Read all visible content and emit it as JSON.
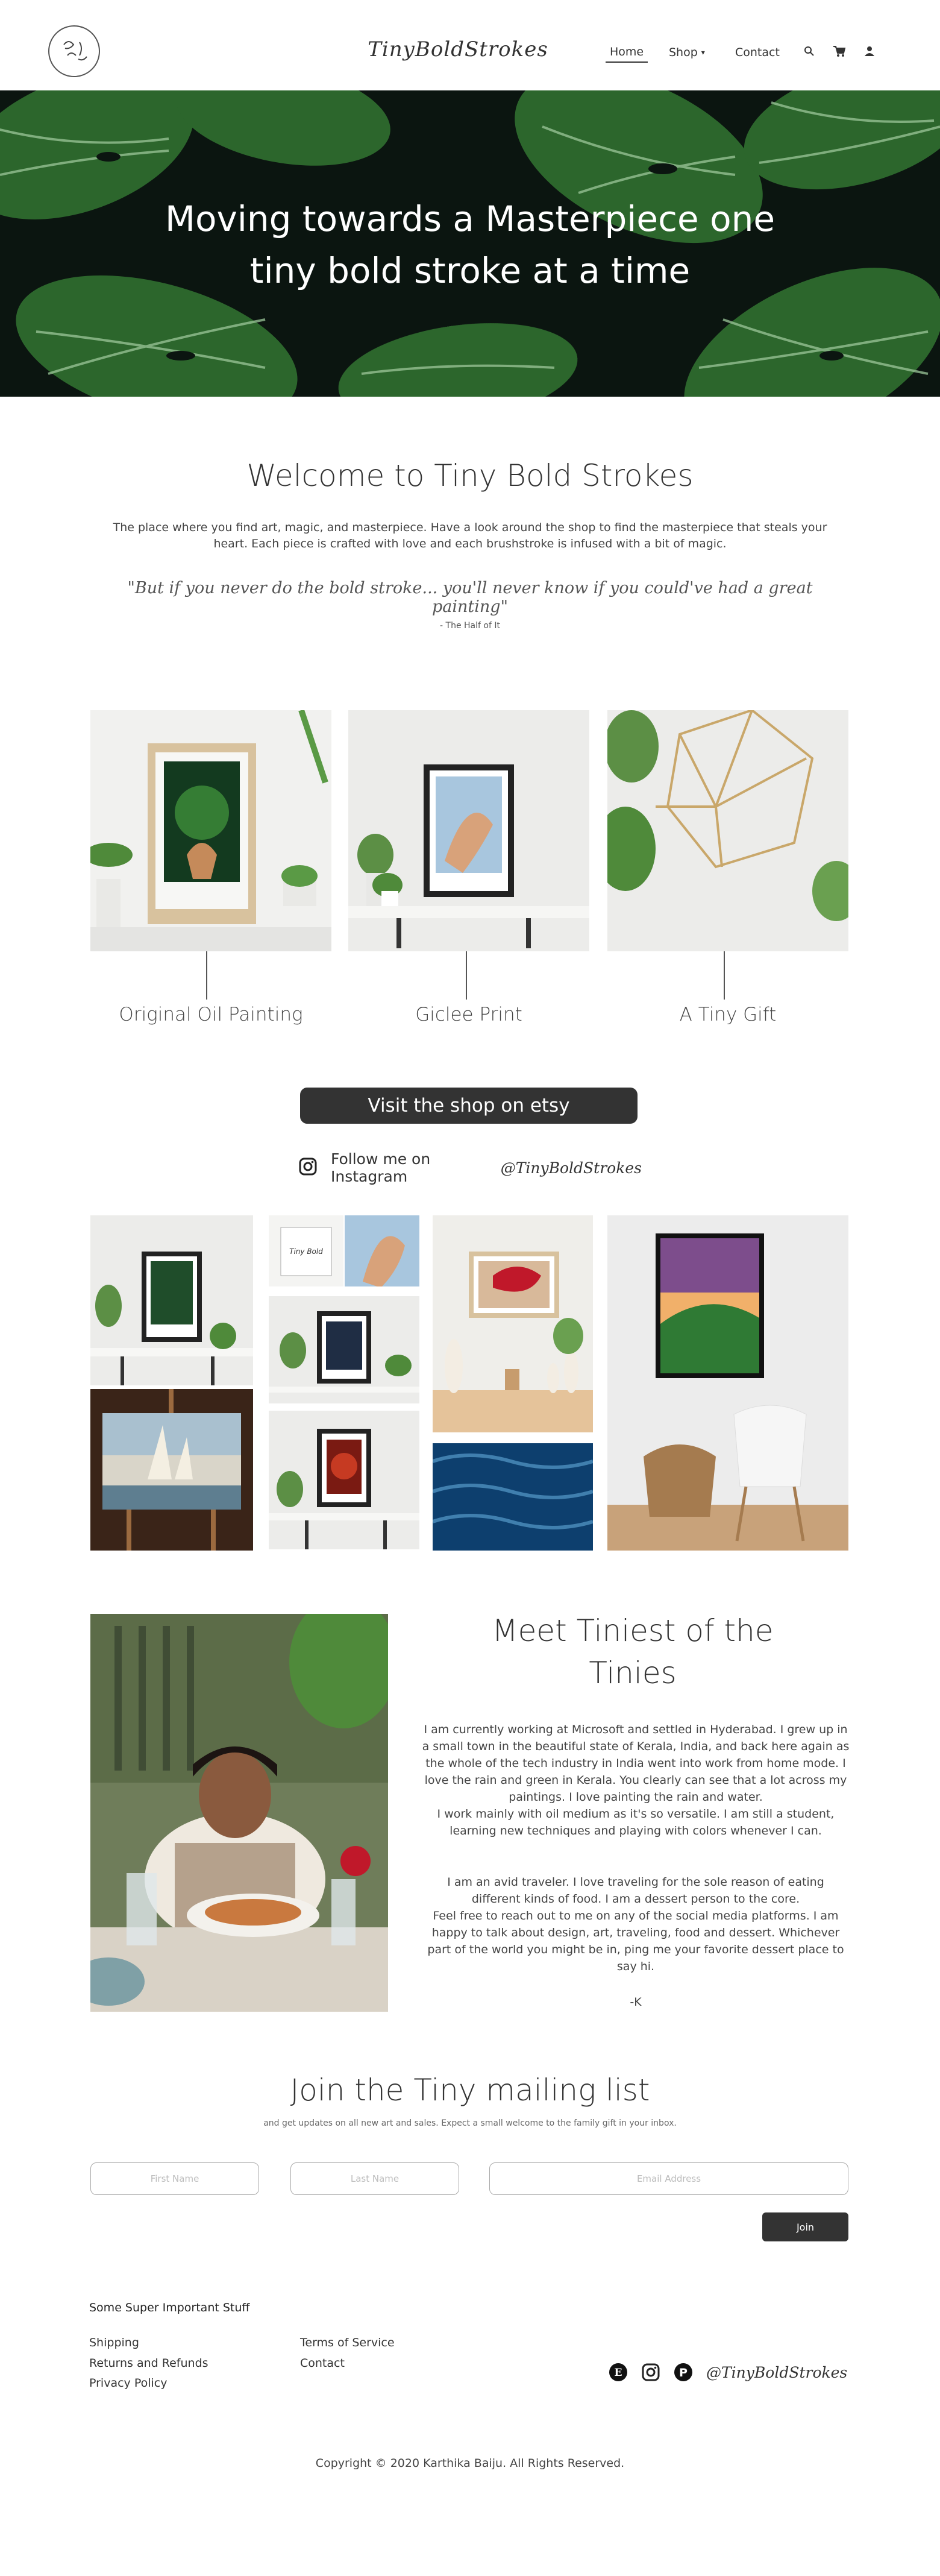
{
  "header": {
    "brand": "TinyBoldStrokes",
    "nav": {
      "home": "Home",
      "shop": "Shop",
      "contact": "Contact"
    },
    "icons": [
      "search-icon",
      "cart-icon",
      "account-icon"
    ]
  },
  "hero": {
    "title_line1": "Moving towards a Masterpiece one",
    "title_line2": "tiny bold stroke at a time"
  },
  "welcome": {
    "title": "Welcome to Tiny Bold Strokes",
    "text": "The place where you find art, magic, and masterpiece. Have a look around the shop to find the masterpiece that steals your heart. Each piece is crafted with love and each brushstroke is infused with a bit of magic.",
    "quote": "\"But if you never do the bold stroke... you'll never know if you could've had a great painting\"",
    "quote_author": "- The Half of It"
  },
  "products": [
    {
      "label": "Original Oil Painting"
    },
    {
      "label": "Giclee Print"
    },
    {
      "label": "A Tiny Gift"
    }
  ],
  "etsy": {
    "button": "Visit the shop on etsy"
  },
  "instagram": {
    "text": "Follow me on Instagram",
    "handle": "@TinyBoldStrokes"
  },
  "about": {
    "title_line1": "Meet Tiniest of the",
    "title_line2": "Tinies",
    "p1": "I am currently working at Microsoft and settled in Hyderabad. I grew up in a small town in the beautiful state of Kerala, India, and back here again as the whole of the tech industry in India went into work from home mode. I love the rain and green in Kerala. You clearly can see that a lot across my paintings. I love painting the rain and water.",
    "p1b": "I work mainly with oil medium as it's so versatile. I am still a student, learning new techniques and playing with colors whenever I can.",
    "p2": "I am an avid traveler. I love traveling for the sole reason of eating different kinds of food. I am a dessert person to the core.",
    "p2b": "Feel free to reach out to me on any of the social media platforms. I am happy to talk about design, art, traveling, food and dessert. Whichever part of the world you might be in, ping me your favorite dessert place to say hi.",
    "sign": "-K"
  },
  "mailing": {
    "title": "Join the Tiny mailing list",
    "subtitle": "and get updates on all new art and sales. Expect a small welcome to the family gift in your inbox.",
    "first_name_placeholder": "First Name",
    "last_name_placeholder": "Last Name",
    "email_placeholder": "Email Address",
    "join": "Join"
  },
  "footer": {
    "heading": "Some Super Important Stuff",
    "col1": [
      "Shipping",
      "Returns and Refunds",
      "Privacy Policy"
    ],
    "col2": [
      "Terms of Service",
      "Contact"
    ],
    "brand": "@TinyBoldStrokes",
    "social_icons": [
      "etsy-icon",
      "instagram-icon",
      "pinterest-icon"
    ],
    "copyright": "Copyright © 2020 Karthika Baiju. All Rights Reserved."
  },
  "colors": {
    "dark": "#333333",
    "hero_bg": "#0b1510",
    "leaf": "#2f6b2f"
  }
}
